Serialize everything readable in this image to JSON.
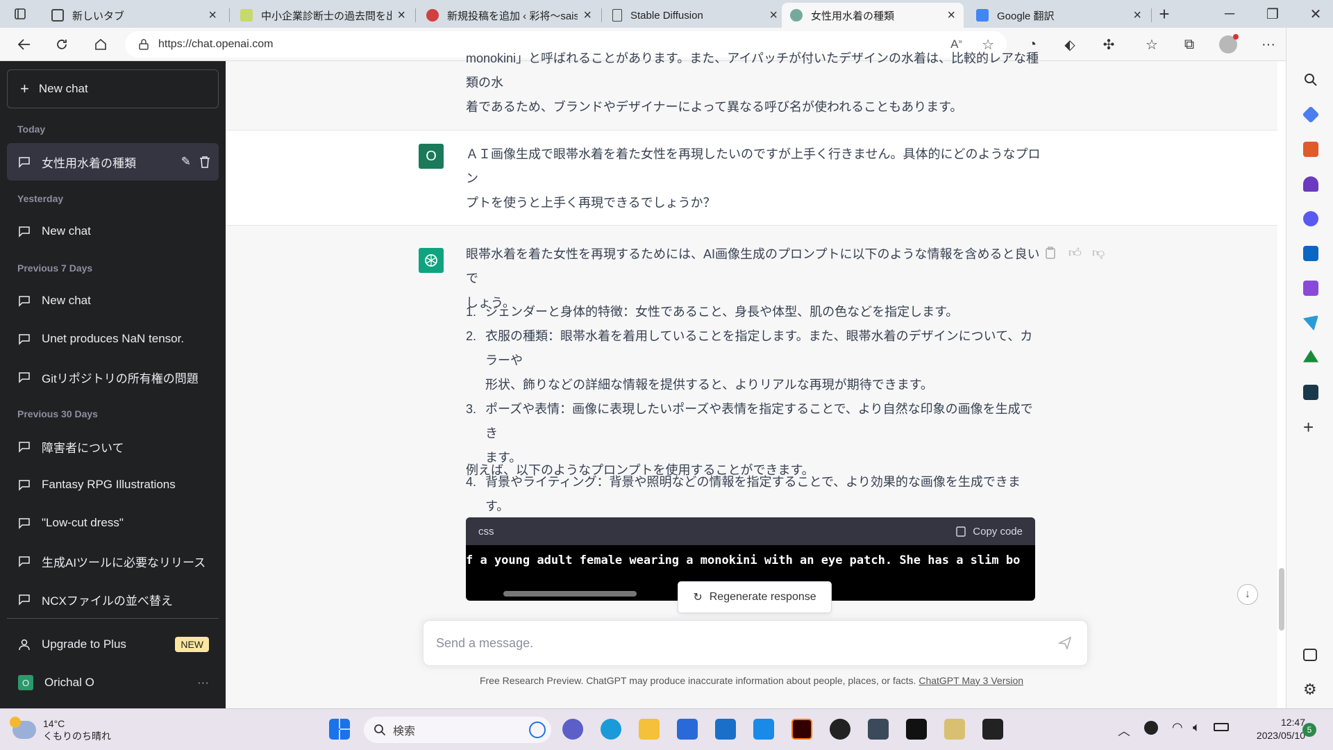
{
  "browser": {
    "tabs": [
      {
        "title": "新しいタブ",
        "fav_color": "#4a4a4a"
      },
      {
        "title": "中小企業診断士の過去問を出",
        "fav_color": "#c6d96a"
      },
      {
        "title": "新規投稿を追加 ‹ 彩将〜sais",
        "fav_color": "#d04040"
      },
      {
        "title": "Stable Diffusion",
        "fav_color": "#ffffff"
      },
      {
        "title": "女性用水着の種類",
        "fav_color": "#74aa9c"
      },
      {
        "title": "Google 翻訳",
        "fav_color": "#4285f4"
      }
    ],
    "new_tab": "+",
    "url": "https://chat.openai.com"
  },
  "sidebar": {
    "new_chat": "New chat",
    "groups": [
      {
        "label": "Today"
      },
      {
        "label": "Yesterday"
      },
      {
        "label": "Previous 7 Days"
      },
      {
        "label": "Previous 30 Days"
      }
    ],
    "items": [
      "女性用水着の種類",
      "New chat",
      "New chat",
      "Unet produces NaN tensor.",
      "Gitリポジトリの所有権の問題",
      "障害者について",
      "Fantasy RPG Illustrations",
      "\"Low-cut dress\"",
      "生成AIツールに必要なリリース",
      "NCXファイルの並べ替え"
    ],
    "upgrade": "Upgrade to Plus",
    "new_badge": "NEW",
    "user": "Orichal O",
    "user_initial": "O",
    "more": "···"
  },
  "conversation": {
    "prev_line1": "monokini」と呼ばれることがあります。また、アイパッチが付いたデザインの水着は、比較的レアな種類の水",
    "prev_line2": "着であるため、ブランドやデザイナーによって異なる呼び名が使われることもあります。",
    "user_initial": "O",
    "user_message_l1": "ＡＩ画像生成で眼帯水着を着た女性を再現したいのですが上手く行きません。具体的にどのようなプロン",
    "user_message_l2": "プトを使うと上手く再現できるでしょうか？",
    "assistant_intro_l1": "眼帯水着を着た女性を再現するためには、AI画像生成のプロンプトに以下のような情報を含めると良いで",
    "assistant_intro_l2": "しょう。",
    "list": [
      {
        "num": "1.",
        "l1": "ジェンダーと身体的特徴：女性であること、身長や体型、肌の色などを指定します。",
        "l2": ""
      },
      {
        "num": "2.",
        "l1": "衣服の種類：眼帯水着を着用していることを指定します。また、眼帯水着のデザインについて、カラーや",
        "l2": "形状、飾りなどの詳細な情報を提供すると、よりリアルな再現が期待できます。"
      },
      {
        "num": "3.",
        "l1": "ポーズや表情：画像に表現したいポーズや表情を指定することで、より自然な印象の画像を生成でき",
        "l2": "ます。"
      },
      {
        "num": "4.",
        "l1": "背景やライティング：背景や照明などの情報を指定することで、より効果的な画像を生成できます。",
        "l2": ""
      }
    ],
    "example_intro": "例えば、以下のようなプロンプトを使用することができます。",
    "code_lang": "css",
    "copy_code": "Copy code",
    "code_text": "f a young adult female wearing a monokini with an eye patch. She has a slim bo",
    "regenerate": "Regenerate response",
    "placeholder": "Send a message.",
    "footer_text": "Free Research Preview. ChatGPT may produce inaccurate information about people, places, or facts. ",
    "footer_link": "ChatGPT May 3 Version"
  },
  "taskbar": {
    "temp": "14°C",
    "weather": "くもりのち晴れ",
    "search": "検索",
    "time": "12:47",
    "date": "2023/05/10",
    "notif": "5"
  }
}
